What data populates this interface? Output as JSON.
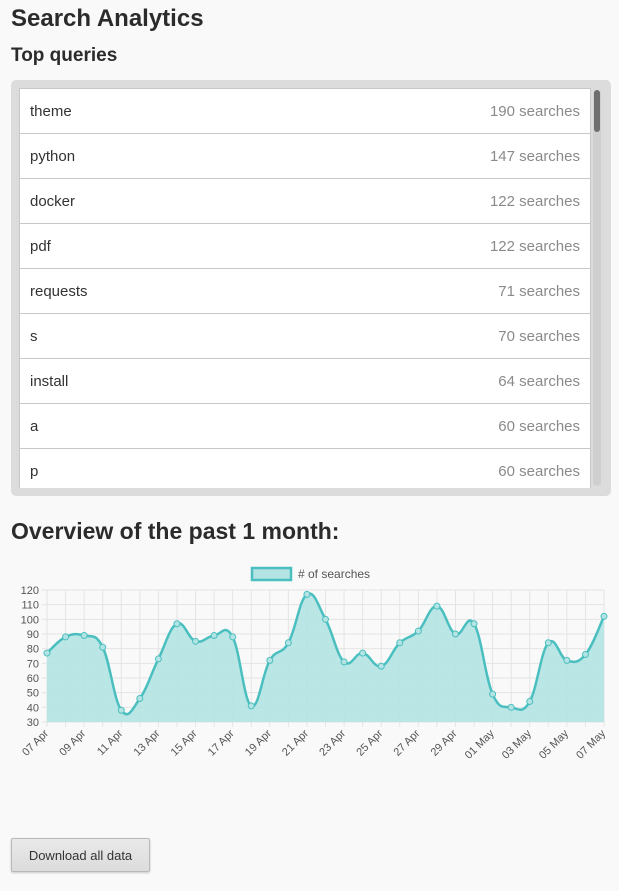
{
  "page_title": "Search Analytics",
  "top_queries": {
    "title": "Top queries",
    "items": [
      {
        "term": "theme",
        "count": "190 searches"
      },
      {
        "term": "python",
        "count": "147 searches"
      },
      {
        "term": "docker",
        "count": "122 searches"
      },
      {
        "term": "pdf",
        "count": "122 searches"
      },
      {
        "term": "requests",
        "count": "71 searches"
      },
      {
        "term": "s",
        "count": "70 searches"
      },
      {
        "term": "install",
        "count": "64 searches"
      },
      {
        "term": "a",
        "count": "60 searches"
      },
      {
        "term": "p",
        "count": "60 searches"
      }
    ]
  },
  "overview": {
    "title": "Overview of the past 1 month:"
  },
  "download_button_label": "Download all data",
  "colors": {
    "series_line": "#4bbfbf",
    "series_fill": "#b3e3e3",
    "grid": "#e4e4e4"
  },
  "chart_data": {
    "type": "area",
    "legend": [
      "# of searches"
    ],
    "legend_position": "top",
    "grid": true,
    "ylim": [
      30,
      120
    ],
    "y_ticks": [
      30,
      40,
      50,
      60,
      70,
      80,
      90,
      100,
      110,
      120
    ],
    "x": [
      "07 Apr",
      "08 Apr",
      "09 Apr",
      "10 Apr",
      "11 Apr",
      "12 Apr",
      "13 Apr",
      "14 Apr",
      "15 Apr",
      "16 Apr",
      "17 Apr",
      "18 Apr",
      "19 Apr",
      "20 Apr",
      "21 Apr",
      "22 Apr",
      "23 Apr",
      "24 Apr",
      "25 Apr",
      "26 Apr",
      "27 Apr",
      "28 Apr",
      "29 Apr",
      "30 Apr",
      "01 May",
      "02 May",
      "03 May",
      "04 May",
      "05 May",
      "06 May",
      "07 May"
    ],
    "x_tick_labels": [
      "07 Apr",
      "09 Apr",
      "11 Apr",
      "13 Apr",
      "15 Apr",
      "17 Apr",
      "19 Apr",
      "21 Apr",
      "23 Apr",
      "25 Apr",
      "27 Apr",
      "29 Apr",
      "01 May",
      "03 May",
      "05 May",
      "07 May"
    ],
    "series": [
      {
        "name": "# of searches",
        "values": [
          77,
          88,
          89,
          81,
          38,
          46,
          73,
          97,
          85,
          89,
          88,
          41,
          72,
          84,
          117,
          100,
          71,
          77,
          68,
          84,
          92,
          109,
          90,
          97,
          49,
          40,
          44,
          84,
          72,
          76,
          102
        ]
      }
    ]
  }
}
